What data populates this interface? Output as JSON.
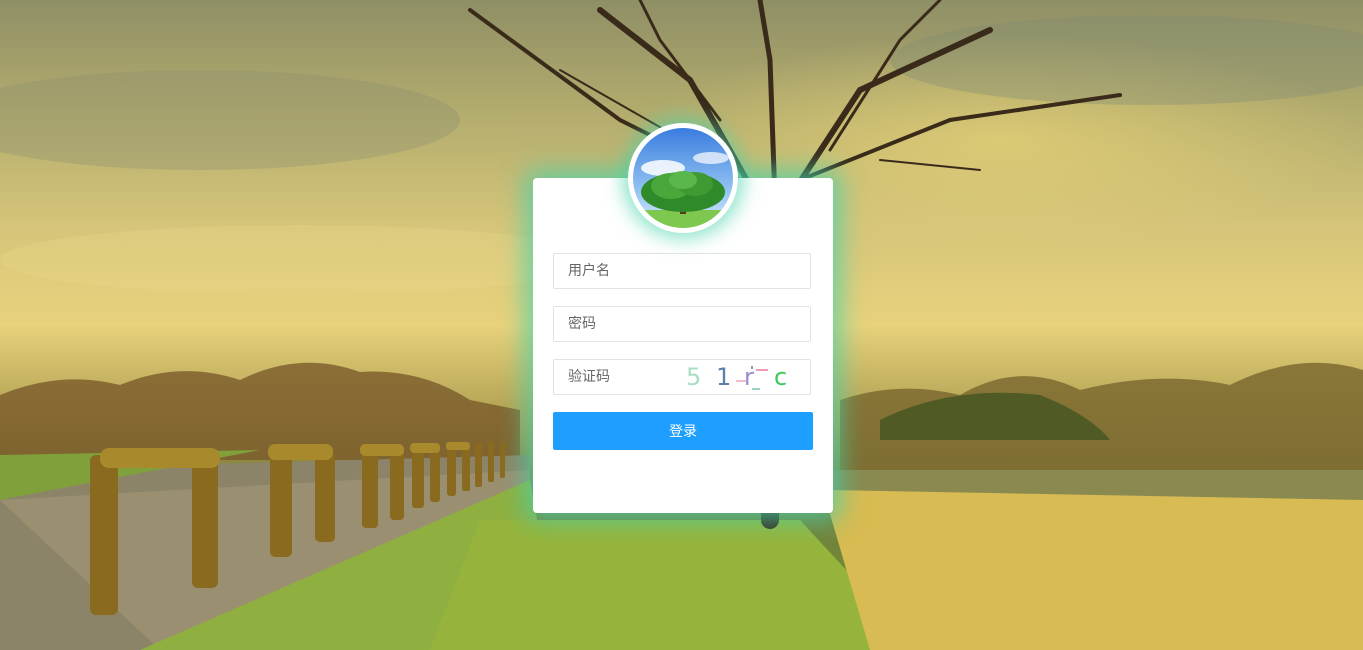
{
  "login_form": {
    "username_placeholder": "用户名",
    "password_placeholder": "密码",
    "captcha_placeholder": "验证码",
    "captcha_chars": [
      "5",
      "1",
      "r",
      "c"
    ],
    "login_label": "登录"
  },
  "colors": {
    "accent": "#1e9fff",
    "glow": "#46d2aa"
  },
  "icons": {
    "avatar": "tree-avatar-image"
  }
}
